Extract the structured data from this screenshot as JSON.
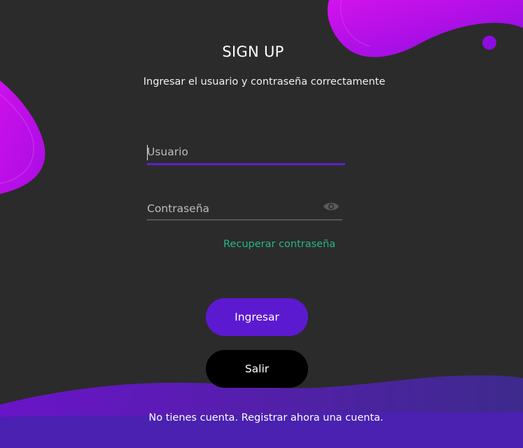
{
  "header": {
    "title": "SIGN UP",
    "subtitle": "Ingresar el usuario y contraseña correctamente"
  },
  "form": {
    "username": {
      "value": "",
      "placeholder": "Usuario"
    },
    "password": {
      "value": "",
      "placeholder": "Contraseña",
      "toggle_icon": "eye-icon"
    },
    "recover_link": "Recuperar contraseña"
  },
  "actions": {
    "login_label": "Ingresar",
    "exit_label": "Salir"
  },
  "footer": {
    "register_text": "No tienes cuenta. Registrar ahora una cuenta."
  },
  "colors": {
    "background": "#2b2b2b",
    "accent": "#5c1ad0",
    "link": "#27b58a",
    "blob_magenta": "#c40ce6",
    "wave_purple": "#4a21b0"
  }
}
